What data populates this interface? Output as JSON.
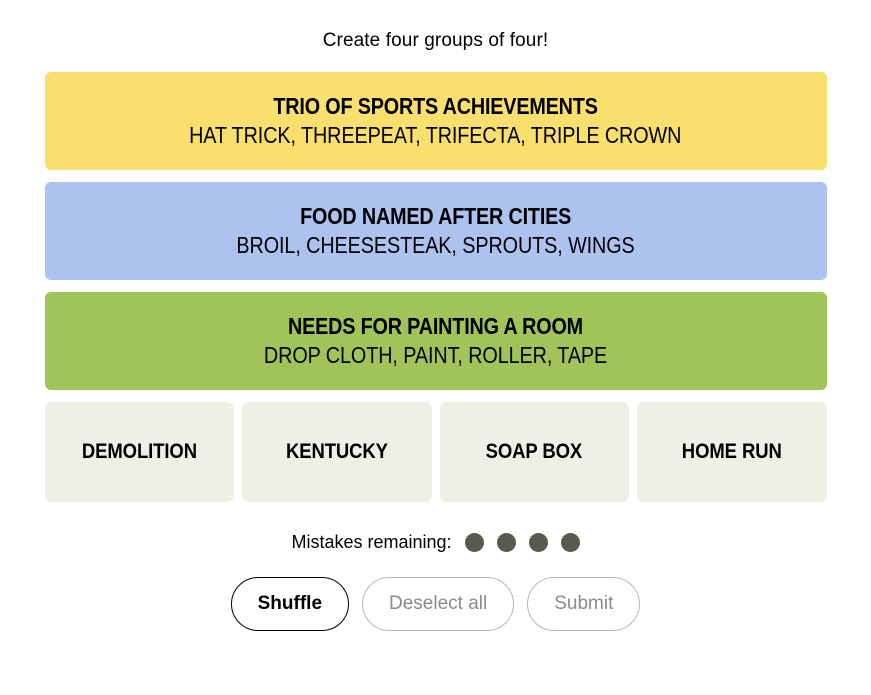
{
  "header": {
    "instruction": "Create four groups of four!"
  },
  "solved_groups": [
    {
      "title": "TRIO OF SPORTS ACHIEVEMENTS",
      "members": "HAT TRICK, THREEPEAT, TRIFECTA, TRIPLE CROWN",
      "color": "#f9df6d"
    },
    {
      "title": "FOOD NAMED AFTER CITIES",
      "members": "BROIL, CHEESESTEAK, SPROUTS, WINGS",
      "color": "#aec2ef"
    },
    {
      "title": "NEEDS FOR PAINTING A ROOM",
      "members": "DROP CLOTH, PAINT, ROLLER, TAPE",
      "color": "#a0c35a"
    }
  ],
  "tiles": [
    {
      "label": "DEMOLITION"
    },
    {
      "label": "KENTUCKY"
    },
    {
      "label": "SOAP BOX"
    },
    {
      "label": "HOME RUN"
    }
  ],
  "mistakes": {
    "label": "Mistakes remaining:",
    "remaining": 4,
    "dot_color": "#5a594e"
  },
  "buttons": [
    {
      "label": "Shuffle",
      "state": "enabled"
    },
    {
      "label": "Deselect all",
      "state": "disabled"
    },
    {
      "label": "Submit",
      "state": "disabled"
    }
  ]
}
